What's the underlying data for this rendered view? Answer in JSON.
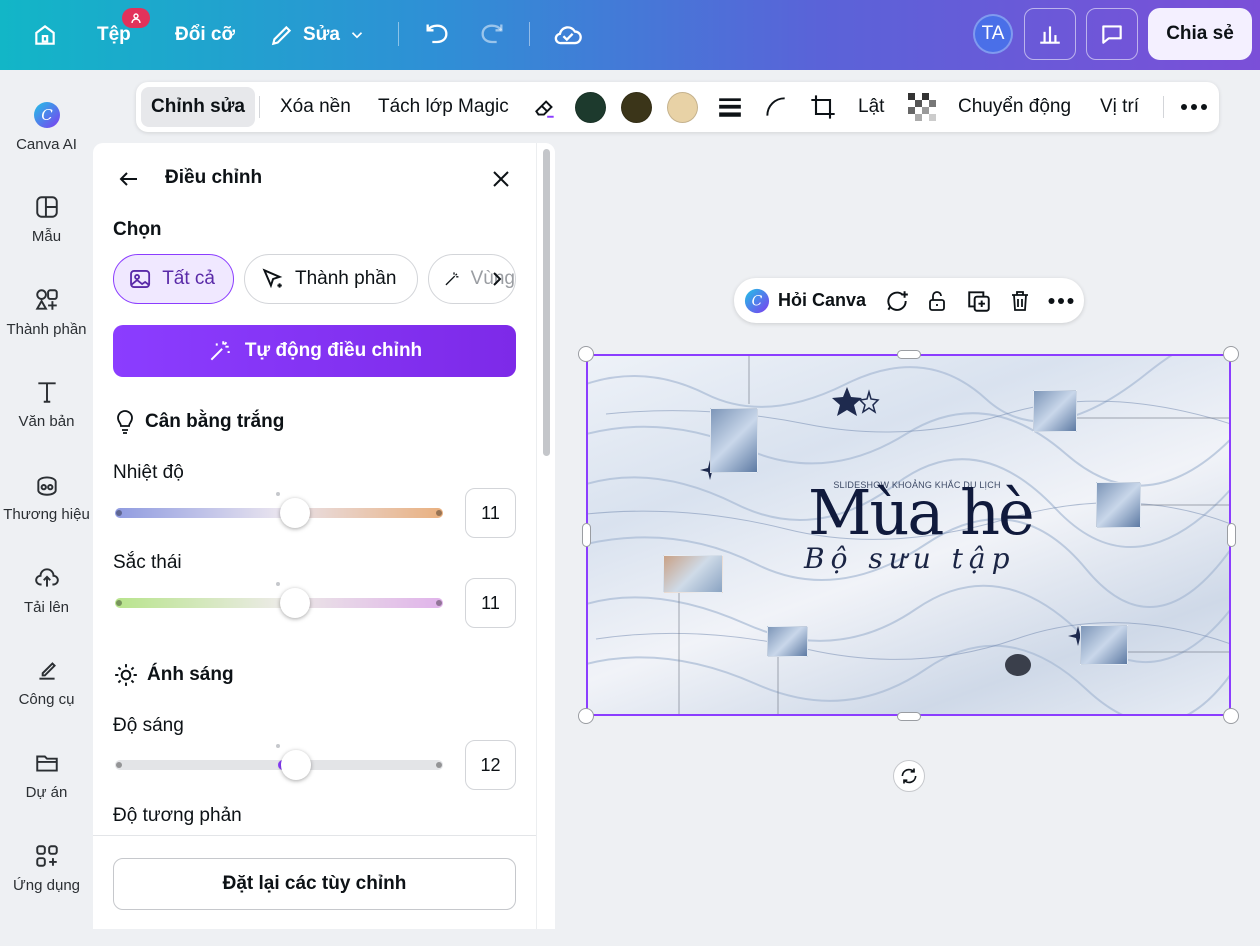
{
  "topbar": {
    "file_label": "Tệp",
    "notif_icon": "user-badge-icon",
    "resize_label": "Đổi cỡ",
    "edit_label": "Sửa",
    "avatar_initials": "TA",
    "share_label": "Chia sẻ",
    "gradient": [
      "#12b6c7",
      "#7b4fd8"
    ]
  },
  "rail": [
    {
      "label": "Canva AI",
      "icon": "canva-ai-icon"
    },
    {
      "label": "Mẫu",
      "icon": "template-icon"
    },
    {
      "label": "Thành phần",
      "icon": "elements-icon"
    },
    {
      "label": "Văn bản",
      "icon": "text-icon"
    },
    {
      "label": "Thương hiệu",
      "icon": "brand-icon"
    },
    {
      "label": "Tải lên",
      "icon": "upload-icon"
    },
    {
      "label": "Công cụ",
      "icon": "tools-icon"
    },
    {
      "label": "Dự án",
      "icon": "folder-icon"
    },
    {
      "label": "Ứng dụng",
      "icon": "apps-icon"
    }
  ],
  "ctxbar": {
    "edit": "Chỉnh sửa",
    "bg_remove": "Xóa nền",
    "magic_layers": "Tách lớp Magic",
    "flip": "Lật",
    "animate": "Chuyển động",
    "position": "Vị trí",
    "swatches": [
      "#1d3a2d",
      "#3b3519",
      "#e8d2a6"
    ]
  },
  "panel": {
    "title": "Điều chỉnh",
    "select_label": "Chọn",
    "chips": [
      "Tất cả",
      "Thành phần",
      "Vùng"
    ],
    "auto_label": "Tự động điều chỉnh",
    "white_balance": "Cân bằng trắng",
    "light": "Ánh sáng",
    "sliders": {
      "temperature": {
        "label": "Nhiệt độ",
        "value": "11"
      },
      "tint": {
        "label": "Sắc thái",
        "value": "11"
      },
      "brightness": {
        "label": "Độ sáng",
        "value": "12"
      },
      "contrast": {
        "label": "Độ tương phản"
      }
    },
    "reset_label": "Đặt lại các tùy chỉnh"
  },
  "floatbar": {
    "ask_label": "Hỏi Canva"
  },
  "design": {
    "small_caption": "SLIDESHOW KHOẢNG KHẮC DU LỊCH",
    "title": "Mùa hè",
    "subtitle": "Bộ sưu tập"
  }
}
